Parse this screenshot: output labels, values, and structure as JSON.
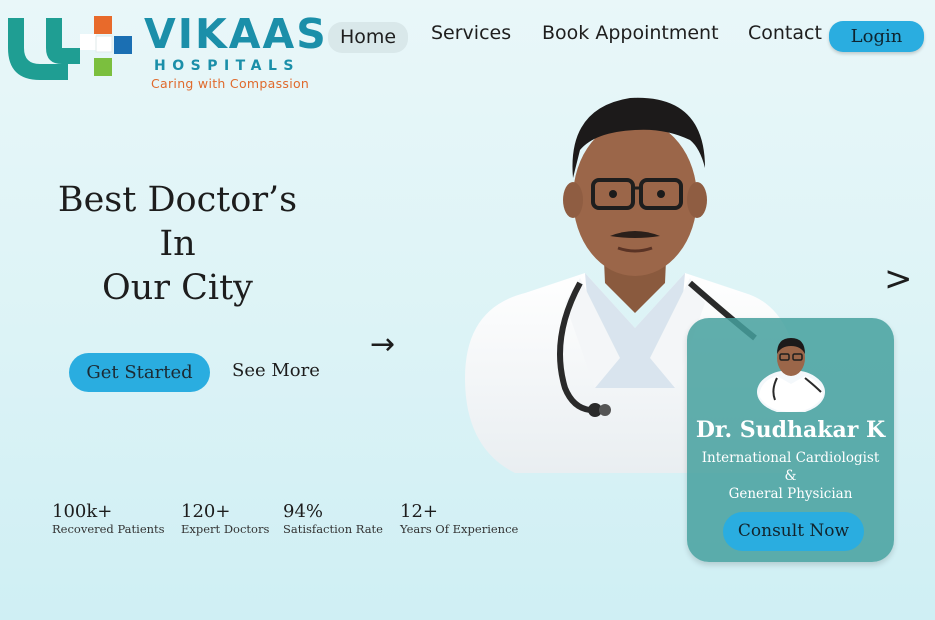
{
  "brand": {
    "name": "VIKAAS",
    "sub": "HOSPITALS",
    "tagline": "Caring with Compassion",
    "colors": {
      "primary": "#1b8fa9",
      "orange": "#e86a2b",
      "green": "#7bbf3e",
      "blue": "#1b6fb3",
      "teal": "#1f9e93"
    }
  },
  "nav": {
    "items": [
      {
        "label": "Home",
        "active": true
      },
      {
        "label": "Services",
        "active": false
      },
      {
        "label": "Book Appointment",
        "active": false
      },
      {
        "label": "Contact",
        "active": false
      }
    ],
    "login": "Login"
  },
  "hero": {
    "title_lines": [
      "Best Doctor’s",
      "In",
      "Our City"
    ],
    "arrow_icon": "→",
    "get_started": "Get Started",
    "see_more": "See More",
    "next_icon": ">"
  },
  "stats": [
    {
      "value": "100k+",
      "label": "Recovered Patients"
    },
    {
      "value": "120+",
      "label": "Expert Doctors"
    },
    {
      "value": "94%",
      "label": "Satisfaction Rate"
    },
    {
      "value": "12+",
      "label": "Years Of Experience"
    }
  ],
  "card": {
    "name": "Dr. Sudhakar K",
    "role_lines": [
      "International Cardiologist",
      "&",
      "General Physician"
    ],
    "button": "Consult Now"
  },
  "colors": {
    "accent": "#2aade0",
    "card": "#45a09e",
    "background": "#def4f7"
  }
}
